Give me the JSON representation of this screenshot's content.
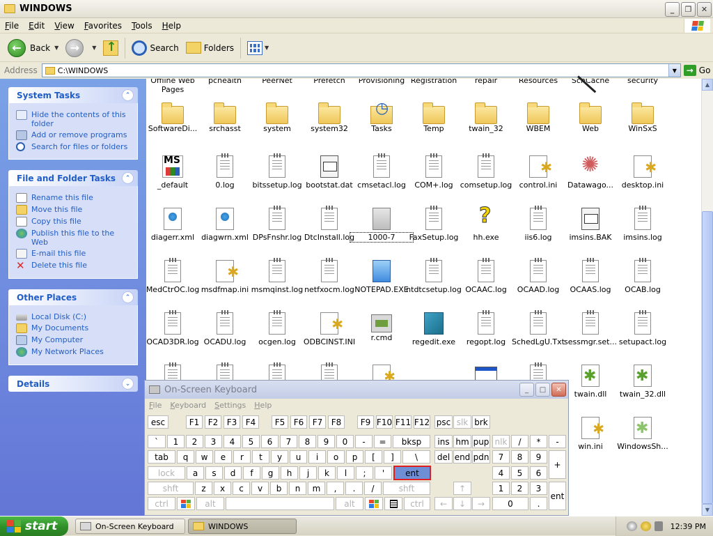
{
  "window": {
    "title": "WINDOWS"
  },
  "menu": [
    "File",
    "Edit",
    "View",
    "Favorites",
    "Tools",
    "Help"
  ],
  "toolbar": {
    "back": "Back",
    "search": "Search",
    "folders": "Folders"
  },
  "address": {
    "label": "Address",
    "value": "C:\\WINDOWS",
    "go": "Go"
  },
  "tasks": {
    "system": {
      "title": "System Tasks",
      "items": [
        "Hide the contents of this folder",
        "Add or remove programs",
        "Search for files or folders"
      ]
    },
    "file": {
      "title": "File and Folder Tasks",
      "items": [
        "Rename this file",
        "Move this file",
        "Copy this file",
        "Publish this file to the Web",
        "E-mail this file",
        "Delete this file"
      ]
    },
    "places": {
      "title": "Other Places",
      "items": [
        "Local Disk (C:)",
        "My Documents",
        "My Computer",
        "My Network Places"
      ]
    },
    "details": {
      "title": "Details"
    }
  },
  "files": {
    "row0": [
      "Offline Web Pages",
      "pchealth",
      "PeerNet",
      "Prefetch",
      "Provisioning",
      "Registration",
      "repair",
      "Resources",
      "SchCache",
      "security"
    ],
    "row1": [
      "SoftwareDi...",
      "srchasst",
      "system",
      "system32",
      "Tasks",
      "Temp",
      "twain_32",
      "WBEM",
      "Web",
      "WinSxS"
    ],
    "row2": [
      "_default",
      "0.log",
      "bitssetup.log",
      "bootstat.dat",
      "cmsetacl.log",
      "COM+.log",
      "comsetup.log",
      "control.ini",
      "Datawago...",
      "desktop.ini"
    ],
    "row3": [
      "diagerr.xml",
      "diagwrn.xml",
      "DPsFnshr.log",
      "DtcInstall.log",
      "1000-7",
      "FaxSetup.log",
      "hh.exe",
      "iis6.log",
      "imsins.BAK",
      "imsins.log"
    ],
    "row4": [
      "MedCtrOC.log",
      "msdfmap.ini",
      "msmqinst.log",
      "netfxocm.log",
      "NOTEPAD.EXE",
      "ntdtcsetup.log",
      "OCAAC.log",
      "OCAAD.log",
      "OCAAS.log",
      "OCAB.log"
    ],
    "row5": [
      "OCAD3DR.log",
      "OCADU.log",
      "ocgen.log",
      "ODBCINST.INI",
      "r.cmd",
      "regedit.exe",
      "regopt.log",
      "SchedLgU.Txt",
      "sessmgr.set...",
      "setupact.log"
    ],
    "row6": [
      "twain.dll",
      "twain_32.dll"
    ],
    "row7": [
      "win.ini",
      "WindowsSh..."
    ]
  },
  "osk": {
    "title": "On-Screen Keyboard",
    "menu": [
      "File",
      "Keyboard",
      "Settings",
      "Help"
    ],
    "row1": [
      "esc",
      "F1",
      "F2",
      "F3",
      "F4",
      "F5",
      "F6",
      "F7",
      "F8",
      "F9",
      "F10",
      "F11",
      "F12",
      "psc",
      "slk",
      "brk"
    ],
    "row2": [
      "`",
      "1",
      "2",
      "3",
      "4",
      "5",
      "6",
      "7",
      "8",
      "9",
      "0",
      "-",
      "=",
      "bksp",
      "ins",
      "hm",
      "pup",
      "nlk",
      "/",
      "*",
      "-"
    ],
    "row3": [
      "tab",
      "q",
      "w",
      "e",
      "r",
      "t",
      "y",
      "u",
      "i",
      "o",
      "p",
      "[",
      "]",
      "\\",
      "del",
      "end",
      "pdn",
      "7",
      "8",
      "9",
      "+"
    ],
    "row4": [
      "lock",
      "a",
      "s",
      "d",
      "f",
      "g",
      "h",
      "j",
      "k",
      "l",
      ";",
      "'",
      "ent",
      "4",
      "5",
      "6"
    ],
    "row5": [
      "shft",
      "z",
      "x",
      "c",
      "v",
      "b",
      "n",
      "m",
      ",",
      ".",
      "/",
      "shft",
      "↑",
      "1",
      "2",
      "3",
      "ent"
    ],
    "row6": [
      "ctrl",
      "alt",
      "alt",
      "ctrl",
      "←",
      "↓",
      "→",
      "0",
      "."
    ]
  },
  "taskbar": {
    "start": "start",
    "items": [
      "On-Screen Keyboard",
      "WINDOWS"
    ],
    "clock": "12:39 PM"
  }
}
